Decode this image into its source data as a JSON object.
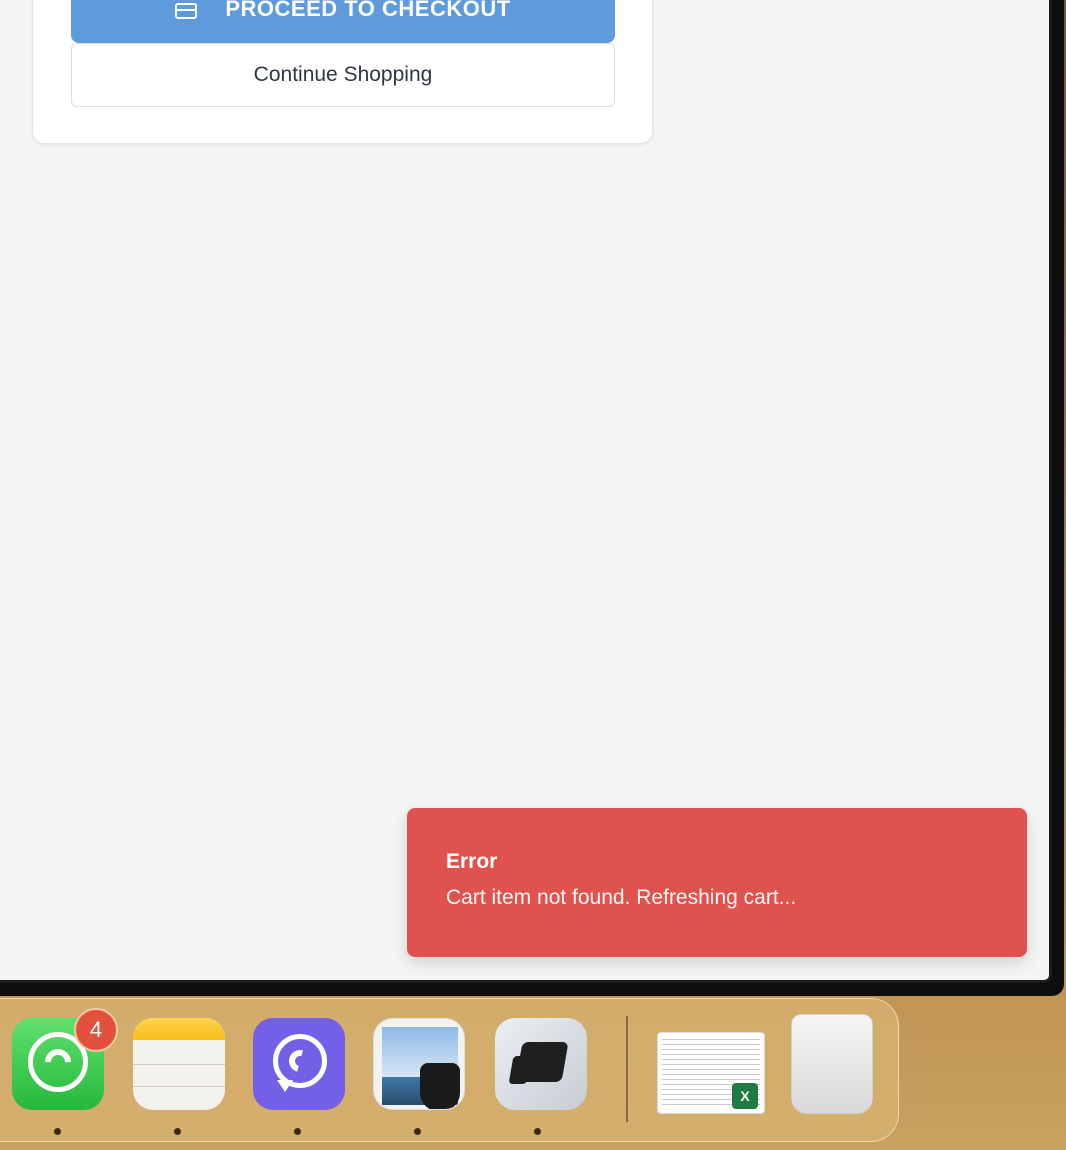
{
  "cart": {
    "checkout_label": "PROCEED TO CHECKOUT",
    "continue_label": "Continue Shopping"
  },
  "toast": {
    "title": "Error",
    "message": "Cart item not found. Refreshing cart..."
  },
  "dock": {
    "items": [
      {
        "name": "WhatsApp",
        "badge": "4"
      },
      {
        "name": "Notes"
      },
      {
        "name": "Viber"
      },
      {
        "name": "Preview"
      },
      {
        "name": "Keyboard app"
      },
      {
        "name": "Excel document"
      },
      {
        "name": "Trash"
      }
    ]
  },
  "colors": {
    "checkout_button": "#5f9bdc",
    "toast_error": "#df524e",
    "page_bg": "#f5f5f5"
  }
}
